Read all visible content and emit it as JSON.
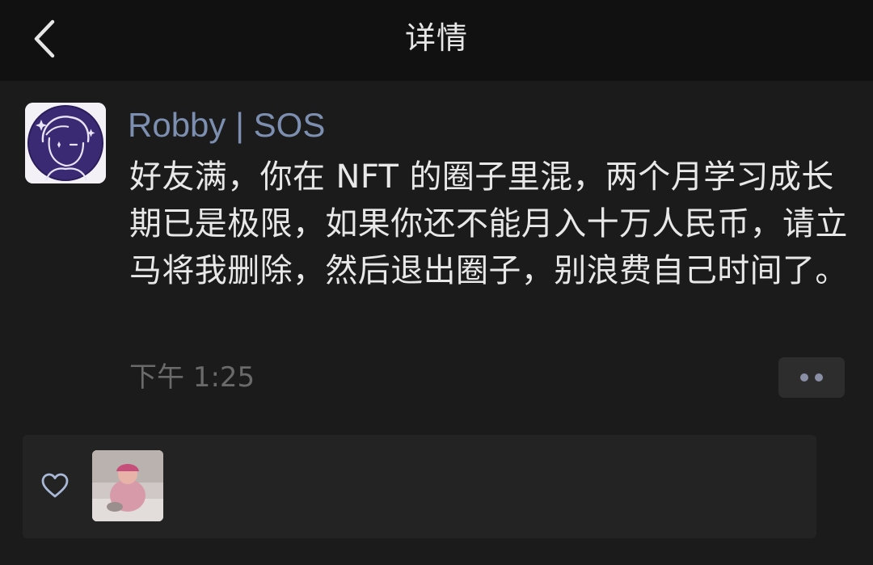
{
  "nav": {
    "title": "详情",
    "back_icon": "chevron-left-icon"
  },
  "post": {
    "author": "Robby | SOS",
    "text": "好友满，你在 NFT 的圈子里混，两个月学习成长期已是极限，如果你还不能月入十万人民币，请立马将我删除，然后退出圈子，别浪费自己时间了。",
    "time": "下午 1:25",
    "more_icon": "more-dots-icon"
  },
  "likes": {
    "icon": "heart-outline-icon",
    "count_avatars": 1
  },
  "colors": {
    "background": "#1b1b1b",
    "nav_background": "#111111",
    "author_name": "#7d8fb0",
    "text": "#e8e8e8",
    "time": "#6a6a6a",
    "panel": "#232323"
  }
}
